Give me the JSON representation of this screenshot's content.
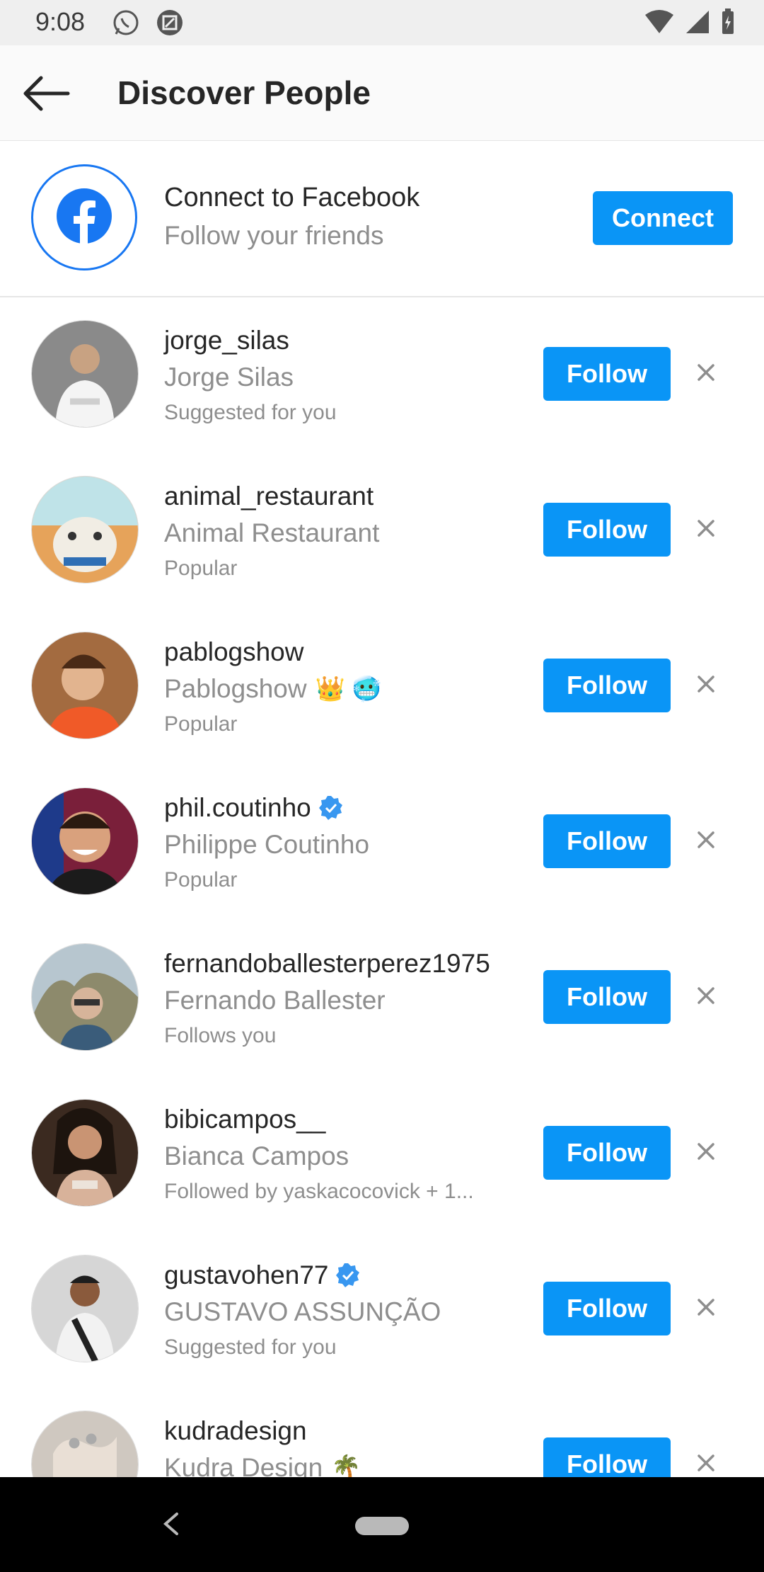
{
  "status_bar": {
    "time": "9:08",
    "icons": [
      "whatsapp-icon",
      "screenshot-icon",
      "wifi-icon",
      "signal-icon",
      "battery-icon"
    ]
  },
  "header": {
    "title": "Discover People",
    "back_icon": "arrow-left-icon"
  },
  "facebook": {
    "title": "Connect to Facebook",
    "subtitle": "Follow your friends",
    "button_label": "Connect",
    "brand_color": "#1877f2"
  },
  "suggestions": [
    {
      "username": "jorge_silas",
      "name": "Jorge Silas",
      "name_extra": "",
      "reason": "Suggested for you",
      "verified": false,
      "follow_label": "Follow"
    },
    {
      "username": "animal_restaurant",
      "name": "Animal Restaurant",
      "name_extra": "",
      "reason": "Popular",
      "verified": false,
      "follow_label": "Follow"
    },
    {
      "username": "pablogshow",
      "name": "Pablogshow",
      "name_extra": "👑 🥶",
      "reason": "Popular",
      "verified": false,
      "follow_label": "Follow"
    },
    {
      "username": "phil.coutinho",
      "name": "Philippe Coutinho",
      "name_extra": "",
      "reason": "Popular",
      "verified": true,
      "follow_label": "Follow"
    },
    {
      "username": "fernandoballesterperez1975",
      "name": "Fernando Ballester",
      "name_extra": "",
      "reason": "Follows you",
      "verified": false,
      "follow_label": "Follow"
    },
    {
      "username": "bibicampos__",
      "name": "Bianca Campos",
      "name_extra": "",
      "reason": "Followed by yaskacocovick + 1...",
      "verified": false,
      "follow_label": "Follow"
    },
    {
      "username": "gustavohen77",
      "name": "GUSTAVO ASSUNÇÃO",
      "name_extra": "",
      "reason": "Suggested for you",
      "verified": true,
      "follow_label": "Follow"
    },
    {
      "username": "kudradesign",
      "name": "Kudra Design",
      "name_extra": "🌴",
      "reason": "",
      "verified": false,
      "follow_label": "Follow"
    }
  ],
  "colors": {
    "accent": "#0a95f6",
    "verified": "#3897f0",
    "secondary_text": "#8e8e8e"
  }
}
